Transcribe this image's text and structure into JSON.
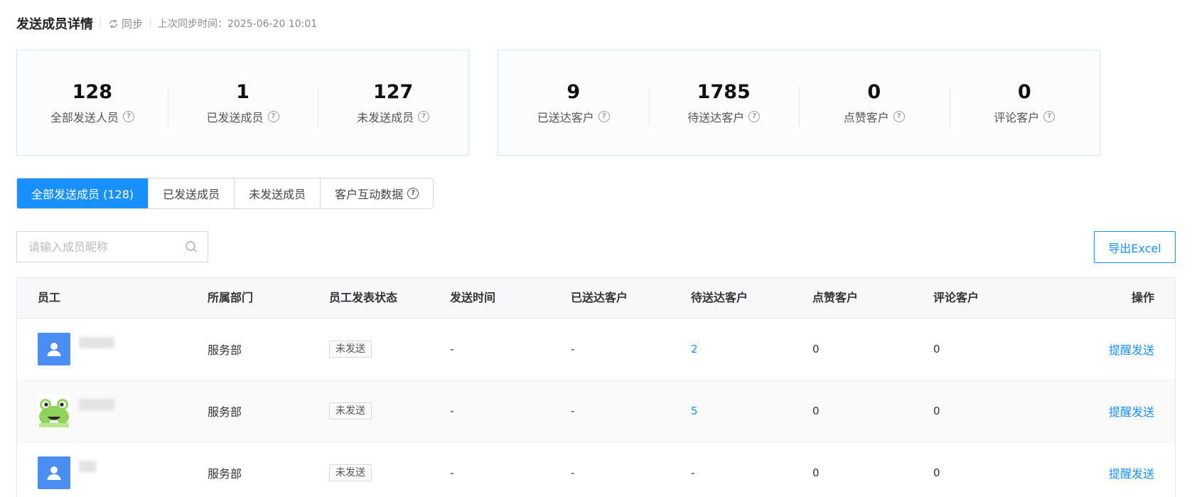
{
  "header": {
    "title": "发送成员详情",
    "sync_label": "同步",
    "last_sync": "上次同步时间：2025-06-20 10:01"
  },
  "member_stats": [
    {
      "value": "128",
      "label": "全部发送人员"
    },
    {
      "value": "1",
      "label": "已发送成员"
    },
    {
      "value": "127",
      "label": "未发送成员"
    }
  ],
  "customer_stats": [
    {
      "value": "9",
      "label": "已送达客户"
    },
    {
      "value": "1785",
      "label": "待送达客户"
    },
    {
      "value": "0",
      "label": "点赞客户"
    },
    {
      "value": "0",
      "label": "评论客户"
    }
  ],
  "tabs": [
    {
      "label": "全部发送成员 (128)",
      "active": true
    },
    {
      "label": "已发送成员",
      "active": false
    },
    {
      "label": "未发送成员",
      "active": false
    },
    {
      "label": "客户互动数据",
      "active": false
    }
  ],
  "search": {
    "placeholder": "请输入成员昵称",
    "value": ""
  },
  "export_label": "导出Excel",
  "table": {
    "columns": [
      "员工",
      "所属部门",
      "员工发表状态",
      "发送时间",
      "已送达客户",
      "待送达客户",
      "点赞客户",
      "评论客户",
      "操作"
    ],
    "rows": [
      {
        "avatar": "default-avatar-icon",
        "dept": "服务部",
        "status": "未发送",
        "send_time": "-",
        "delivered": "-",
        "pending": "2",
        "likes": "0",
        "comments": "0",
        "action": "提醒发送"
      },
      {
        "avatar": "frog-avatar",
        "dept": "服务部",
        "status": "未发送",
        "send_time": "-",
        "delivered": "-",
        "pending": "5",
        "likes": "0",
        "comments": "0",
        "action": "提醒发送"
      },
      {
        "avatar": "default-avatar-icon",
        "dept": "服务部",
        "status": "未发送",
        "send_time": "-",
        "delivered": "-",
        "pending": "-",
        "likes": "0",
        "comments": "0",
        "action": "提醒发送"
      }
    ]
  },
  "colors": {
    "accent": "#1890ff",
    "avatar_bg": "#4a8ef4",
    "card_border": "#cde8f6"
  }
}
